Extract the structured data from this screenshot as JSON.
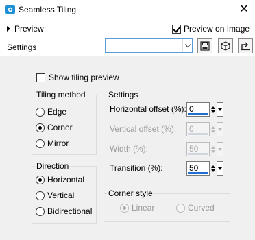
{
  "window": {
    "title": "Seamless Tiling",
    "close_glyph": "✕"
  },
  "header": {
    "preview_label": "Preview",
    "preview_on_image": {
      "label": "Preview on Image",
      "checked": true
    },
    "settings_label": "Settings",
    "settings_value": ""
  },
  "show_tiling_preview": {
    "label": "Show tiling preview",
    "checked": false
  },
  "tiling_method": {
    "title": "Tiling method",
    "options": [
      {
        "label": "Edge",
        "checked": false
      },
      {
        "label": "Corner",
        "checked": true
      },
      {
        "label": "Mirror",
        "checked": false
      }
    ]
  },
  "direction": {
    "title": "Direction",
    "options": [
      {
        "label": "Horizontal",
        "checked": true
      },
      {
        "label": "Vertical",
        "checked": false
      },
      {
        "label": "Bidirectional",
        "checked": false
      }
    ]
  },
  "settings_group": {
    "title": "Settings",
    "fields": [
      {
        "label": "Horizontal offset (%):",
        "value": "0",
        "enabled": true
      },
      {
        "label": "Vertical offset (%):",
        "value": "0",
        "enabled": false
      },
      {
        "label": "Width (%):",
        "value": "50",
        "enabled": false
      },
      {
        "label": "Transition (%):",
        "value": "50",
        "enabled": true
      }
    ]
  },
  "corner_style": {
    "title": "Corner style",
    "options": [
      {
        "label": "Linear",
        "checked": true,
        "enabled": false
      },
      {
        "label": "Curved",
        "checked": false,
        "enabled": false
      }
    ]
  },
  "icons": {
    "app": "seamless-tiling-app-icon",
    "save": "save-icon",
    "load": "load-preset-icon",
    "reset": "reset-icon"
  },
  "colors": {
    "accent": "#1f6fd0",
    "select_border": "#5a9ad6"
  }
}
